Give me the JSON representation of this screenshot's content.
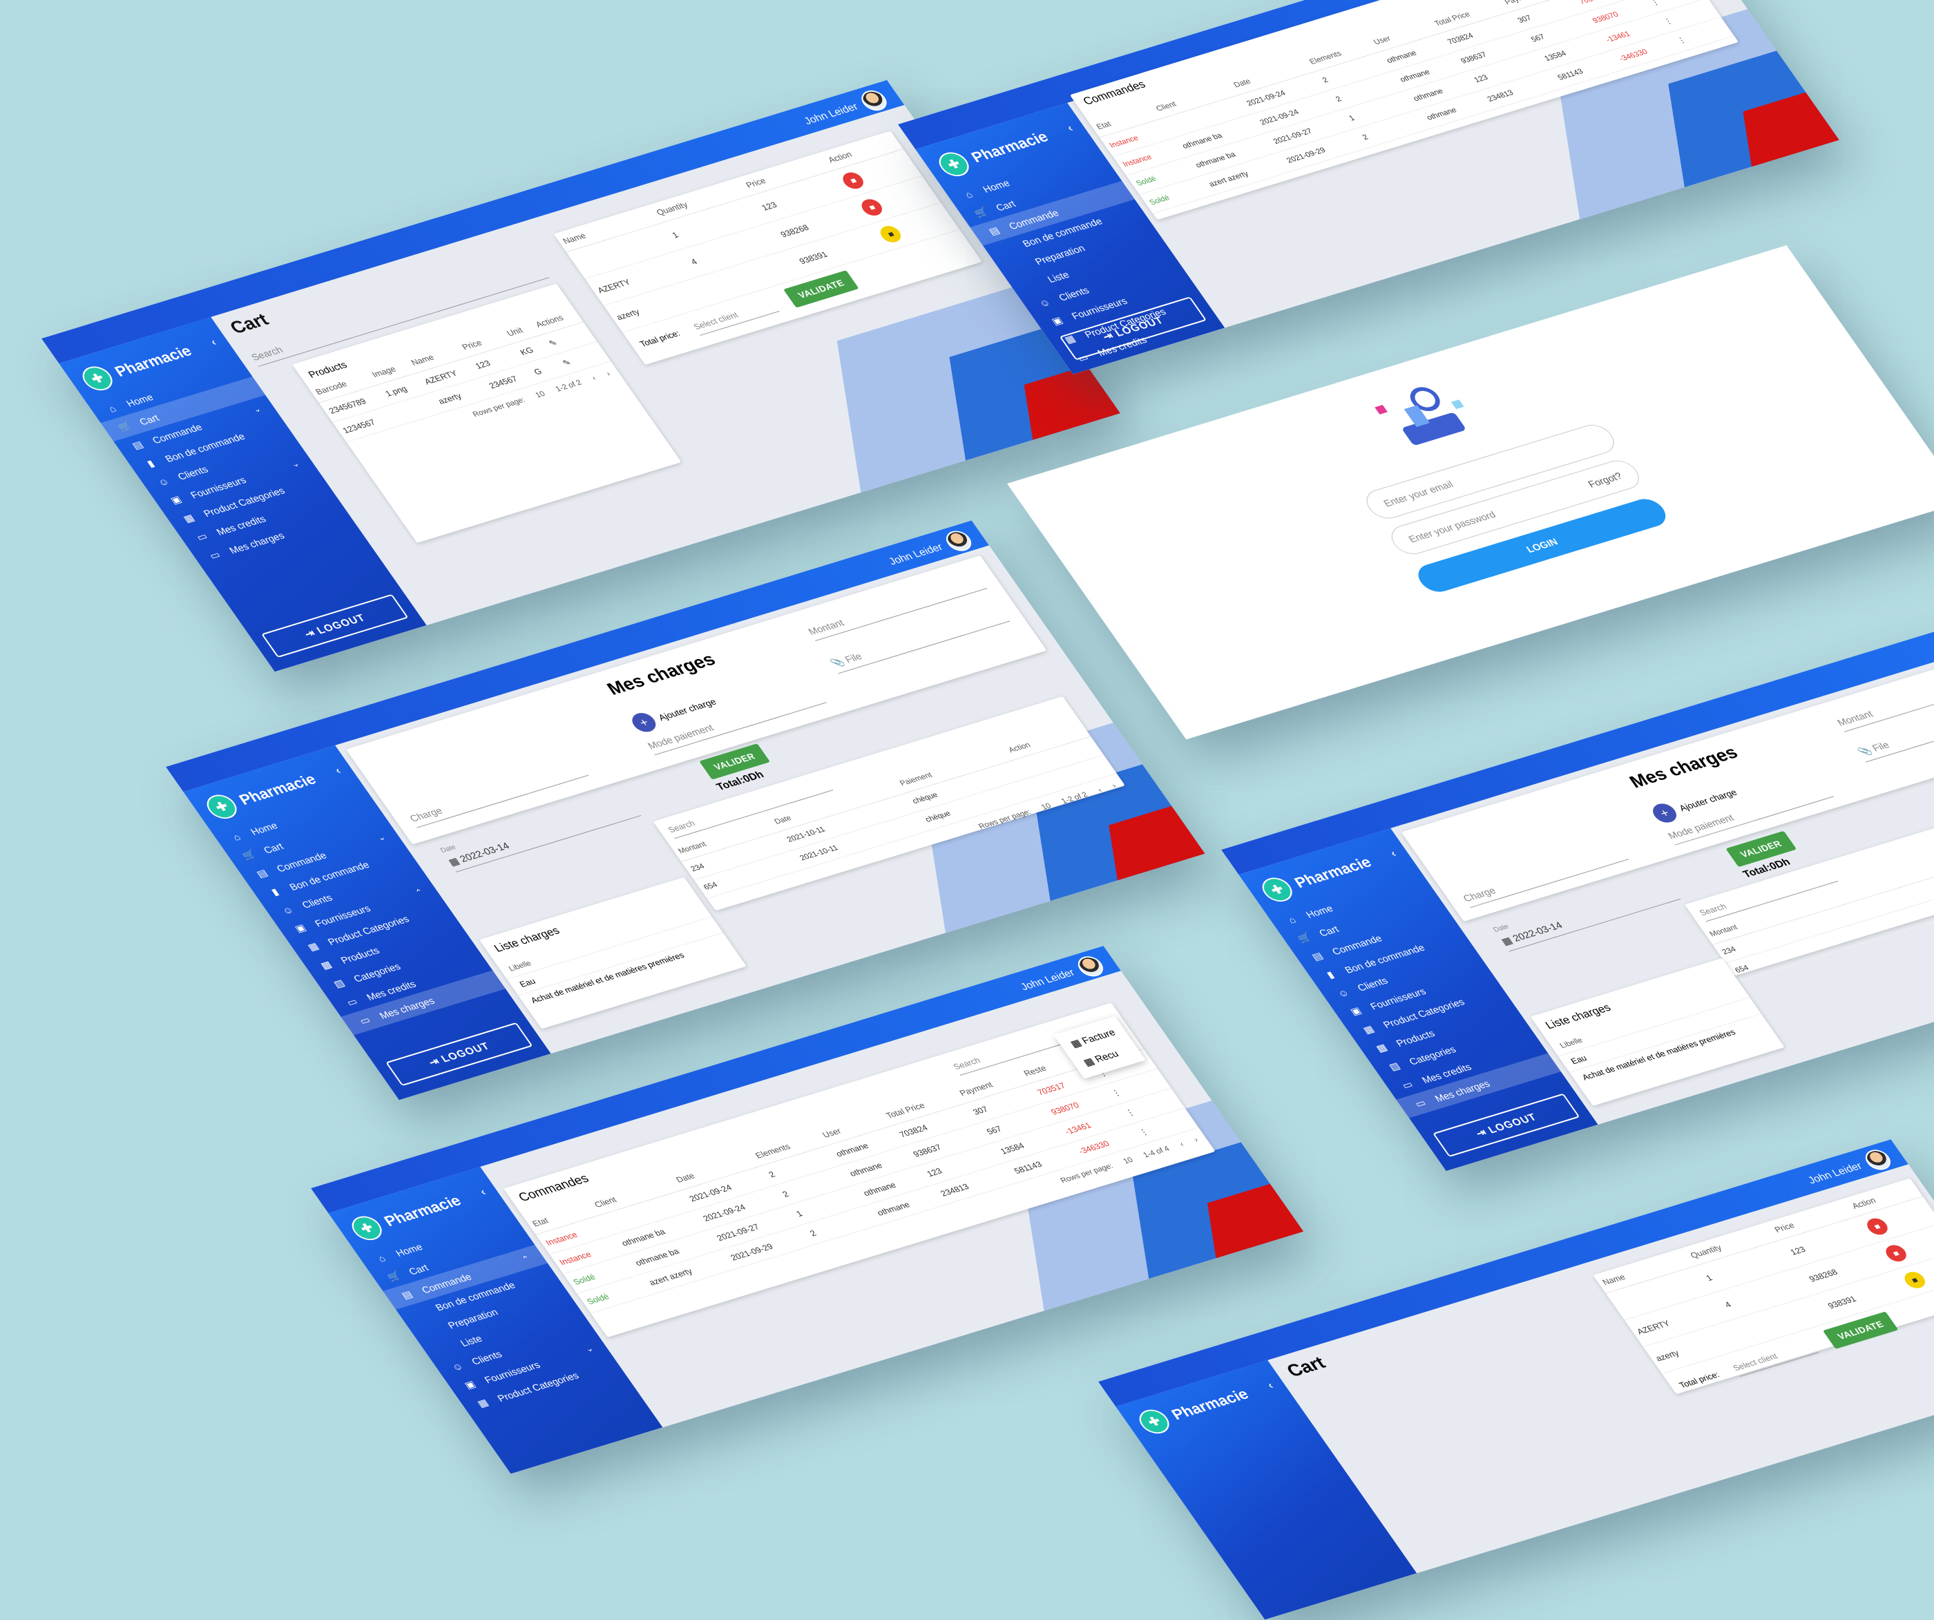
{
  "app": {
    "brand": "Pharmacie",
    "user": "John Leider",
    "logout": "LOGOUT"
  },
  "nav_full": [
    "Home",
    "Cart",
    "Commande",
    "Bon de commande",
    "Clients",
    "Fournisseurs",
    "Product Categories",
    "Products",
    "Categories",
    "Mes credits",
    "Mes charges"
  ],
  "nav_cart": [
    "Home",
    "Cart",
    "Commande",
    "Bon de commande",
    "Clients",
    "Fournisseurs",
    "Product Categories",
    "Mes credits",
    "Mes charges"
  ],
  "nav_cmd": [
    "Home",
    "Cart",
    "Commande",
    "Bon de commande",
    "Preparation",
    "Liste",
    "Clients",
    "Fournisseurs",
    "Product Categories",
    "Mes credits",
    "Mes charges"
  ],
  "cart": {
    "title": "Cart",
    "search": "Search",
    "products_title": "Products",
    "headers": [
      "Barcode",
      "Image",
      "Name",
      "Price",
      "Unit",
      "Actions"
    ],
    "rows": [
      [
        "23456789",
        "1.png",
        "AZERTY",
        "123",
        "KG"
      ],
      [
        "1234567",
        "",
        "azerty",
        "234567",
        "G"
      ]
    ],
    "rows_per_page_label": "Rows per page:",
    "rows_per_page": "10",
    "range": "1-2 of 2",
    "cart_headers": [
      "Name",
      "Quantity",
      "Price",
      "Action"
    ],
    "cart_rows": [
      [
        "",
        "1",
        "123"
      ],
      [
        "AZERTY",
        "4",
        "938268"
      ],
      [
        "azerty",
        "",
        "938391"
      ]
    ],
    "total_label": "Total price:",
    "select_client": "Select client",
    "validate": "VALIDATE"
  },
  "commandes": {
    "title": "Commandes",
    "search": "Search",
    "headers": [
      "Etat",
      "Client",
      "Date",
      "Elements",
      "User",
      "Total Price",
      "Payment",
      "Reste",
      "Actions"
    ],
    "rows": [
      {
        "etat": "Instance",
        "client": "",
        "date": "2021-09-24",
        "el": "2",
        "user": "othmane",
        "total": "703824",
        "pay": "307",
        "reste": "703517"
      },
      {
        "etat": "Instance",
        "client": "othmane ba",
        "date": "2021-09-24",
        "el": "2",
        "user": "othmane",
        "total": "938637",
        "pay": "567",
        "reste": "938070"
      },
      {
        "etat": "Soldé",
        "client": "othmane ba",
        "date": "2021-09-27",
        "el": "1",
        "user": "othmane",
        "total": "123",
        "pay": "13584",
        "reste": "-13461"
      },
      {
        "etat": "Soldé",
        "client": "azert azerty",
        "date": "2021-09-29",
        "el": "2",
        "user": "othmane",
        "total": "234813",
        "pay": "581143",
        "reste": "-346330"
      }
    ],
    "menu": [
      "Facture",
      "Recu"
    ],
    "rows_per_page_label": "Rows per page:",
    "rows_per_page": "10",
    "range": "1-4 of 4"
  },
  "login": {
    "email": "Enter your email",
    "password": "Enter your password",
    "forgot": "Forgot?",
    "button": "LOGIN"
  },
  "charges": {
    "title": "Mes charges",
    "montant": "Montant",
    "ajouter": "Ajouter charge",
    "file": "File",
    "charge": "Charge",
    "mode": "Mode paiement",
    "valider": "VALIDER",
    "date_label": "Date",
    "date": "2022-03-14",
    "total": "Total:0Dh",
    "search": "Search",
    "headers": [
      "Montant",
      "Date",
      "Paiement",
      "Action"
    ],
    "rows": [
      [
        "234",
        "2021-10-11",
        "chèque"
      ],
      [
        "654",
        "2021-10-11",
        "chèque"
      ]
    ],
    "rows_per_page_label": "Rows per page:",
    "rows_per_page": "10",
    "range": "1-2 of 2",
    "liste_title": "Liste charges",
    "libelle": "Libelle",
    "libelles": [
      "Eau",
      "Achat de matériel et de matières premières"
    ]
  },
  "colors": {
    "primary": "#1a4fd6",
    "green": "#43a047",
    "red": "#e53935",
    "bg": "#b4dbe1"
  }
}
